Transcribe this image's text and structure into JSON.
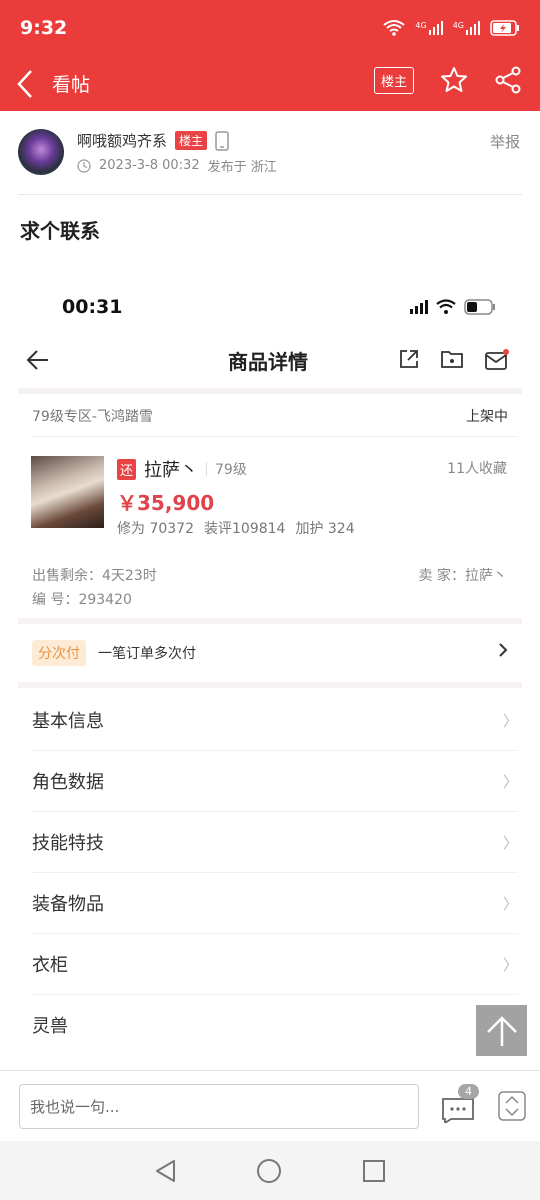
{
  "status_bar": {
    "time": "9:32",
    "net1": "4G",
    "net2": "4G"
  },
  "nav": {
    "title": "看帖",
    "louzhu_label": "楼主"
  },
  "post": {
    "author": "啊哦额鸡齐系",
    "author_badge": "楼主",
    "timestamp": "2023-3-8 00:32",
    "location": "发布于 浙江",
    "report": "举报",
    "title": "求个联系"
  },
  "embedded": {
    "time": "00:31",
    "page_title": "商品详情",
    "zone": "79级专区-飞鸿踏雪",
    "status": "上架中",
    "product": {
      "tag": "还",
      "name": "拉萨丶",
      "level": "79级",
      "favorites": "11人收藏",
      "price": "￥35,900",
      "xiuwei": "修为 70372",
      "zhuangping": "装评109814",
      "jiahu": "加护 324"
    },
    "sell_remaining": "出售剩余：4天23时",
    "seller": "卖 家：拉萨丶",
    "serial": "编 号：293420",
    "pay_tag": "分次付",
    "pay_text": "一笔订单多次付",
    "menu": [
      {
        "label": "基本信息"
      },
      {
        "label": "角色数据"
      },
      {
        "label": "技能特技"
      },
      {
        "label": "装备物品"
      },
      {
        "label": "衣柜"
      },
      {
        "label": "灵兽"
      }
    ]
  },
  "comment": {
    "placeholder": "我也说一句...",
    "count": "4"
  },
  "colors": {
    "brand_red": "#ea3c3a",
    "price_red": "#e0434a",
    "pay_tag_bg": "#fdebd5"
  }
}
